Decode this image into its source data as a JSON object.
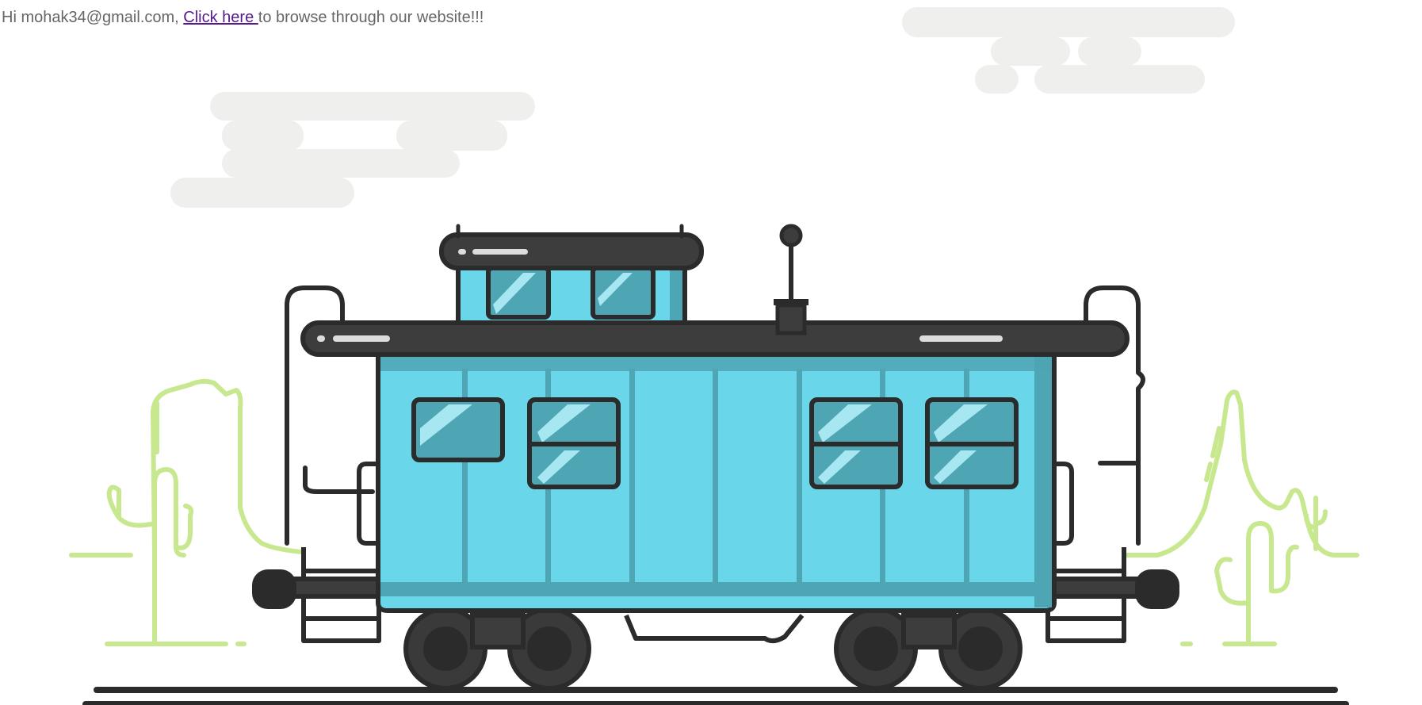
{
  "greeting": {
    "prefix": "Hi mohak34@gmail.com, ",
    "link_text": "Click here ",
    "suffix": "to browse through our website!!!"
  },
  "illustration": {
    "subject": "caboose-train-car",
    "colors": {
      "cloud": "#eff0ee",
      "cactus": "#c8e88f",
      "car_body": "#6ad6ea",
      "car_stripe": "#4ea5b4",
      "window_glass": "#4ea5b4",
      "window_shine": "#a7e7f2",
      "outline": "#2b2b2b",
      "roof": "#3d3d3d",
      "roof_highlight": "#dcdcdc",
      "wheel": "#3a3a3a",
      "rail": "#2b2b2b"
    }
  }
}
